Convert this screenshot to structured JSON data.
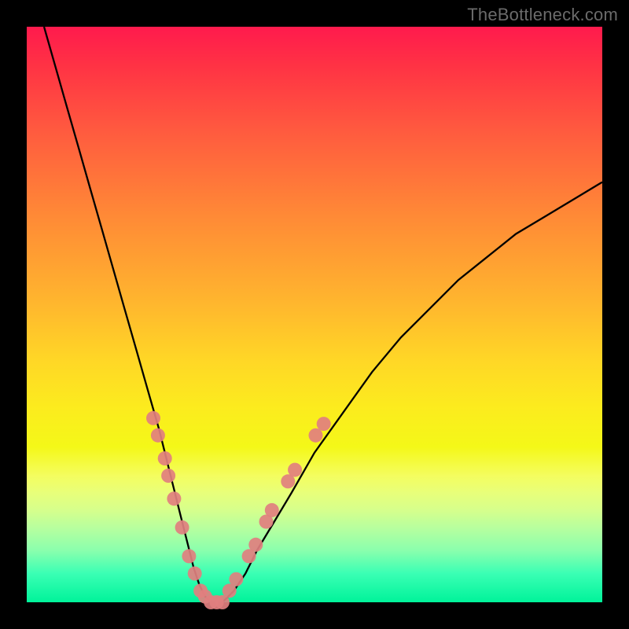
{
  "watermark": "TheBottleneck.com",
  "chart_data": {
    "type": "line",
    "title": "",
    "xlabel": "",
    "ylabel": "",
    "xlim": [
      0,
      100
    ],
    "ylim": [
      0,
      100
    ],
    "grid": false,
    "legend": false,
    "series": [
      {
        "name": "curve",
        "x": [
          3,
          5,
          7,
          9,
          11,
          13,
          15,
          17,
          19,
          21,
          23,
          24,
          25,
          26,
          27,
          28,
          29,
          30,
          31,
          32,
          33,
          34,
          36,
          38,
          40,
          43,
          46,
          50,
          55,
          60,
          65,
          70,
          75,
          80,
          85,
          90,
          95,
          100
        ],
        "y": [
          100,
          93,
          86,
          79,
          72,
          65,
          58,
          51,
          44,
          37,
          30,
          26,
          22,
          18,
          14,
          10,
          6,
          3,
          1,
          0,
          0,
          0,
          2,
          5,
          9,
          14,
          19,
          26,
          33,
          40,
          46,
          51,
          56,
          60,
          64,
          67,
          70,
          73
        ]
      }
    ],
    "markers": [
      {
        "x": 22.0,
        "y": 32
      },
      {
        "x": 22.8,
        "y": 29
      },
      {
        "x": 24.0,
        "y": 25
      },
      {
        "x": 24.6,
        "y": 22
      },
      {
        "x": 25.6,
        "y": 18
      },
      {
        "x": 27.0,
        "y": 13
      },
      {
        "x": 28.2,
        "y": 8
      },
      {
        "x": 29.2,
        "y": 5
      },
      {
        "x": 30.2,
        "y": 2
      },
      {
        "x": 31.0,
        "y": 1
      },
      {
        "x": 32.0,
        "y": 0
      },
      {
        "x": 33.0,
        "y": 0
      },
      {
        "x": 34.0,
        "y": 0
      },
      {
        "x": 35.2,
        "y": 2
      },
      {
        "x": 36.4,
        "y": 4
      },
      {
        "x": 38.6,
        "y": 8
      },
      {
        "x": 39.8,
        "y": 10
      },
      {
        "x": 41.6,
        "y": 14
      },
      {
        "x": 42.6,
        "y": 16
      },
      {
        "x": 45.4,
        "y": 21
      },
      {
        "x": 46.6,
        "y": 23
      },
      {
        "x": 50.2,
        "y": 29
      },
      {
        "x": 51.6,
        "y": 31
      }
    ],
    "marker_radius": 9
  }
}
